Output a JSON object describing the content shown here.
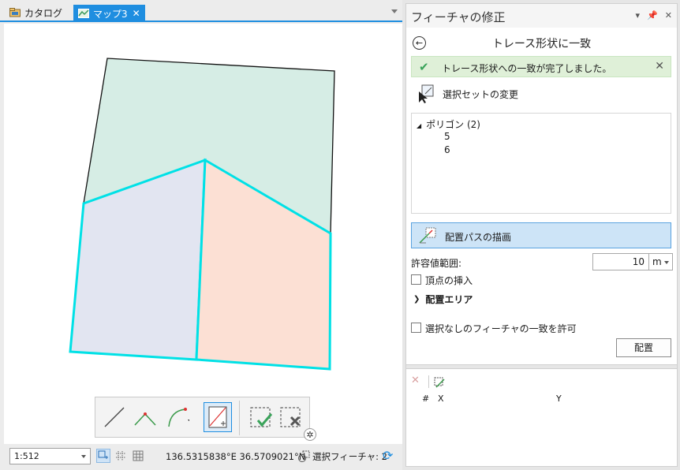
{
  "tabs": [
    {
      "label": "カタログ",
      "active": false
    },
    {
      "label": "マップ3",
      "active": true
    }
  ],
  "map": {
    "colors": {
      "green_fill": "#d6ede5",
      "blue_fill": "#e2e5f1",
      "orange_fill": "#fce0d4",
      "selection": "#00e1e6",
      "outline": "#111111"
    }
  },
  "edit_toolbar": {
    "tools": [
      "line-icon",
      "angle-icon",
      "arc-icon",
      "trace-icon",
      "finish-sketch-icon",
      "cancel-sketch-icon"
    ]
  },
  "status": {
    "scale": "1:512",
    "coordinates": "136.5315838°E 36.5709021°N",
    "selected_features": "選択フィーチャ: 2"
  },
  "pane": {
    "title": "フィーチャの修正",
    "tool_title": "トレース形状に一致",
    "message": "トレース形状への一致が完了しました。",
    "selection_change": "選択セットの変更",
    "tree": {
      "group": "ポリゴン (2)",
      "items": [
        "5",
        "6"
      ]
    },
    "draw_path": "配置パスの描画",
    "tolerance_label": "許容値範囲:",
    "tolerance_value": "10",
    "tolerance_unit": "m",
    "insert_vertices": "頂点の挿入",
    "placement_area": "配置エリア",
    "allow_unselected": "選択なしのフィーチャの一致を許可",
    "place_button": "配置",
    "grid": {
      "columns": [
        "#",
        "X",
        "Y"
      ]
    }
  }
}
